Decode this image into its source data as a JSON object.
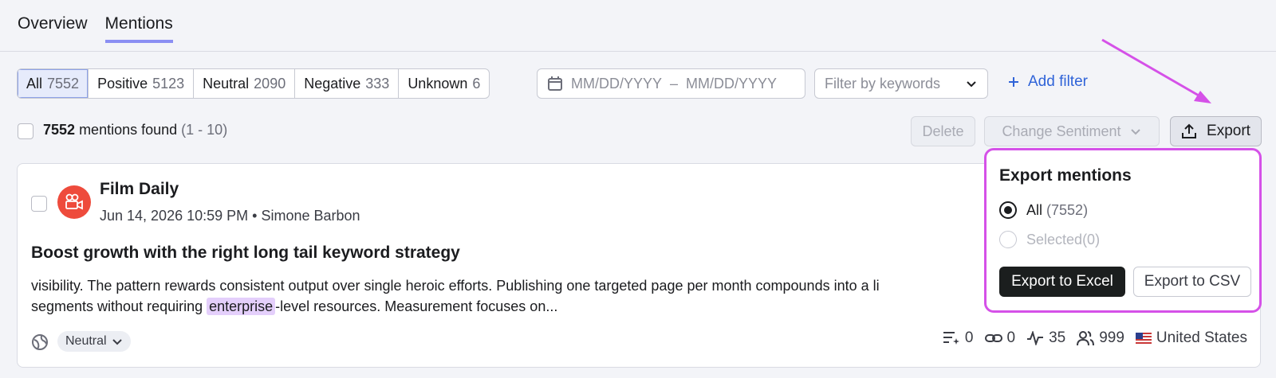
{
  "tabs": [
    {
      "label": "Overview"
    },
    {
      "label": "Mentions"
    }
  ],
  "sentiment_filter": [
    {
      "label": "All",
      "count": "7552"
    },
    {
      "label": "Positive",
      "count": "5123"
    },
    {
      "label": "Neutral",
      "count": "2090"
    },
    {
      "label": "Negative",
      "count": "333"
    },
    {
      "label": "Unknown",
      "count": "6"
    }
  ],
  "date_range": {
    "start": "MM/DD/YYYY",
    "separator": "–",
    "end": "MM/DD/YYYY"
  },
  "keyword_filter": {
    "placeholder": "Filter by keywords"
  },
  "add_filter": {
    "label": "Add filter"
  },
  "results": {
    "count": "7552",
    "text": "mentions found",
    "range": "(1 - 10)"
  },
  "actions": {
    "delete": "Delete",
    "change_sentiment": "Change Sentiment",
    "export": "Export"
  },
  "mention": {
    "source": "Film Daily",
    "date": "Jun 14, 2026 10:59 PM",
    "bullet": "•",
    "author": "Simone Barbon",
    "title": "Boost growth with the right long tail keyword strategy",
    "body_line1": "visibility. The pattern rewards consistent output over single heroic efforts. Publishing one targeted page per month compounds into a li",
    "body_line2_before": "segments without requiring ",
    "body_highlight": "enterprise",
    "body_line2_after": "-level resources. Measurement focuses on...",
    "sentiment": "Neutral",
    "stats": {
      "lists": "0",
      "links": "0",
      "activity": "35",
      "reach": "999",
      "country": "United States"
    }
  },
  "export_popover": {
    "title": "Export mentions",
    "option_all": "All",
    "option_all_count": "(7552)",
    "option_selected": "Selected",
    "option_selected_count": "(0)",
    "excel_button": "Export to Excel",
    "csv_button": "Export to CSV"
  },
  "colors": {
    "accent": "#2f63d8",
    "highlight_border": "#d551e8",
    "avatar": "#ee4b3c"
  }
}
